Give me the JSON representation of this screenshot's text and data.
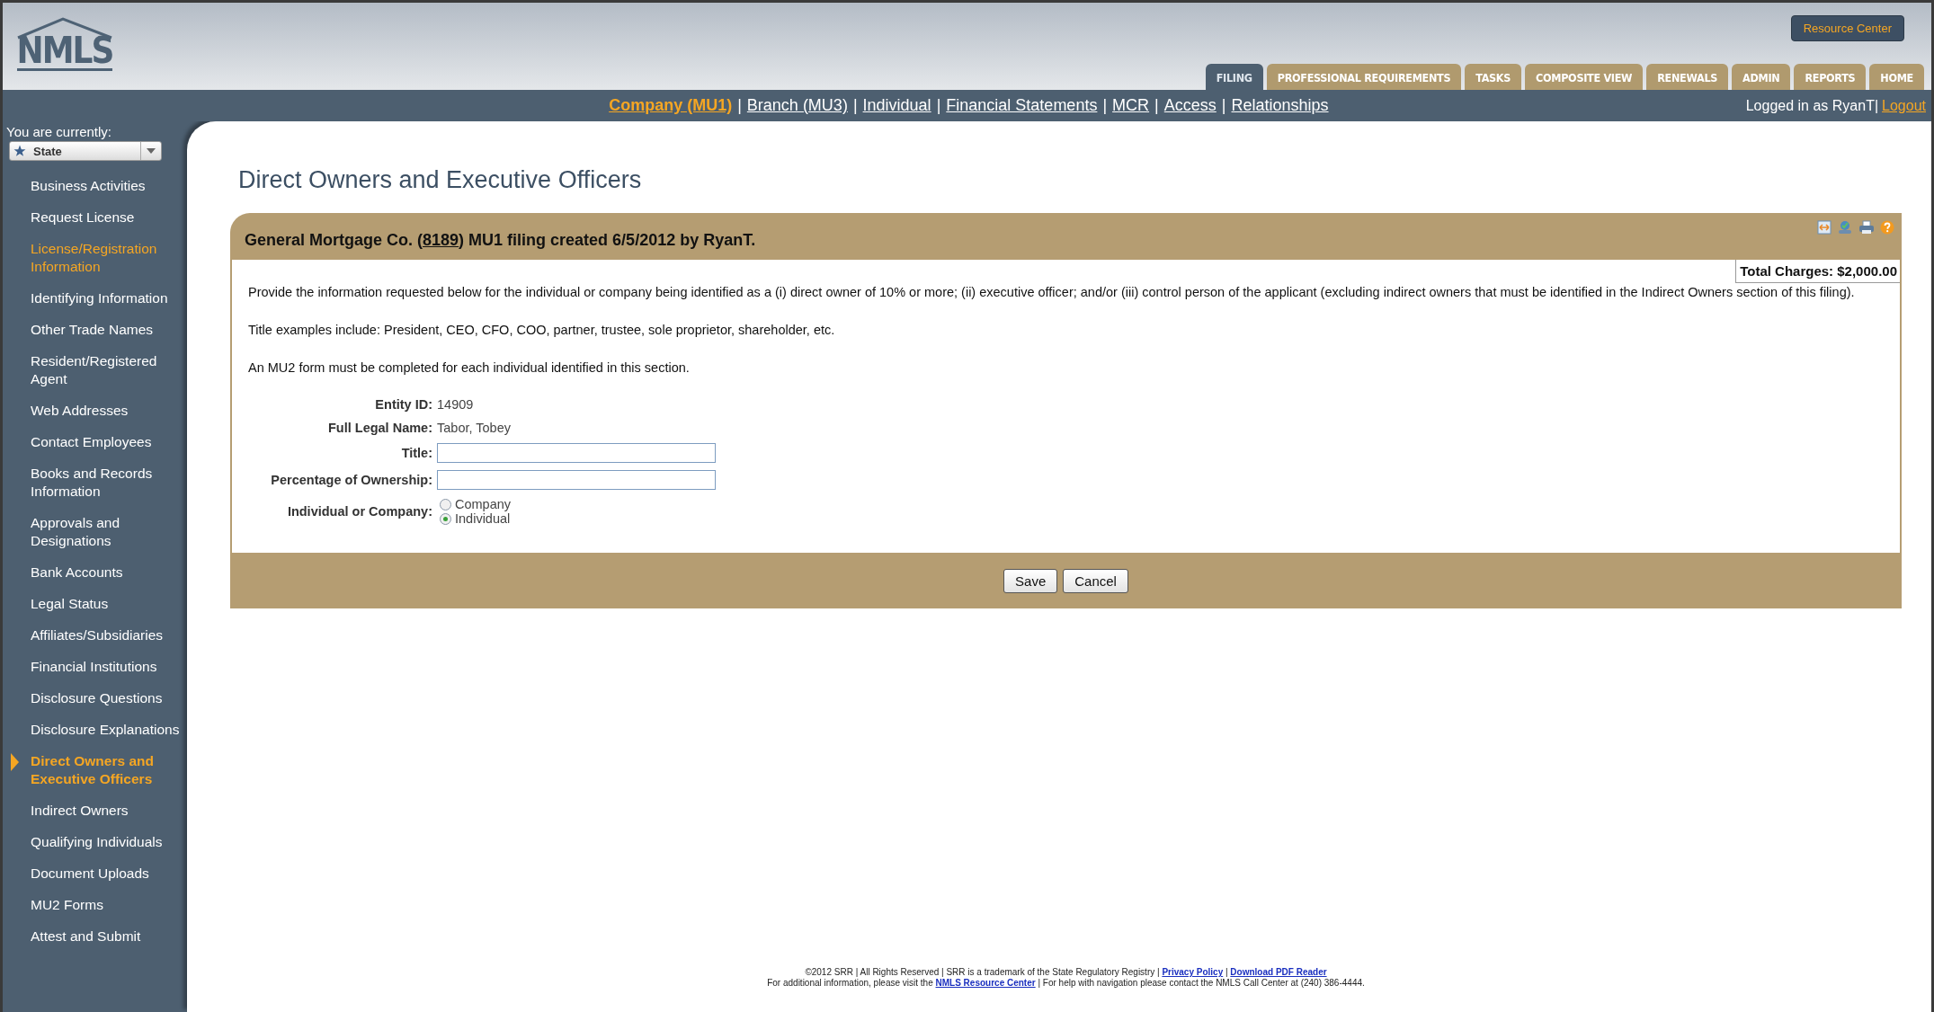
{
  "header": {
    "logo": "NMLS",
    "resource_button": "Resource Center",
    "tabs": [
      {
        "label": "FILING",
        "selected": true
      },
      {
        "label": "PROFESSIONAL REQUIREMENTS",
        "selected": false
      },
      {
        "label": "TASKS",
        "selected": false
      },
      {
        "label": "COMPOSITE VIEW",
        "selected": false
      },
      {
        "label": "RENEWALS",
        "selected": false
      },
      {
        "label": "ADMIN",
        "selected": false
      },
      {
        "label": "REPORTS",
        "selected": false
      },
      {
        "label": "HOME",
        "selected": false
      }
    ]
  },
  "subnav": {
    "separator": "|",
    "links": [
      {
        "label": "Company (MU1)",
        "selected": true
      },
      {
        "label": "Branch (MU3)",
        "selected": false
      },
      {
        "label": "Individual",
        "selected": false
      },
      {
        "label": "Financial Statements",
        "selected": false
      },
      {
        "label": "MCR",
        "selected": false
      },
      {
        "label": "Access",
        "selected": false
      },
      {
        "label": "Relationships",
        "selected": false
      }
    ],
    "logged_in": "Logged in as RyanT|",
    "logout": "Logout"
  },
  "sidebar": {
    "caption": "You are currently:",
    "dropdown": "State",
    "items": [
      {
        "label": "Business Activities",
        "selected": false,
        "highlighted": false
      },
      {
        "label": "Request License",
        "selected": false,
        "highlighted": false
      },
      {
        "label": "License/Registration Information",
        "selected": false,
        "highlighted": true
      },
      {
        "label": "Identifying Information",
        "selected": false,
        "highlighted": false
      },
      {
        "label": "Other Trade Names",
        "selected": false,
        "highlighted": false
      },
      {
        "label": "Resident/Registered Agent",
        "selected": false,
        "highlighted": false
      },
      {
        "label": "Web Addresses",
        "selected": false,
        "highlighted": false
      },
      {
        "label": "Contact Employees",
        "selected": false,
        "highlighted": false
      },
      {
        "label": "Books and Records Information",
        "selected": false,
        "highlighted": false
      },
      {
        "label": "Approvals and Designations",
        "selected": false,
        "highlighted": false
      },
      {
        "label": "Bank Accounts",
        "selected": false,
        "highlighted": false
      },
      {
        "label": "Legal Status",
        "selected": false,
        "highlighted": false
      },
      {
        "label": "Affiliates/Subsidiaries",
        "selected": false,
        "highlighted": false
      },
      {
        "label": "Financial Institutions",
        "selected": false,
        "highlighted": false
      },
      {
        "label": "Disclosure Questions",
        "selected": false,
        "highlighted": false
      },
      {
        "label": "Disclosure Explanations",
        "selected": false,
        "highlighted": false
      },
      {
        "label": "Direct Owners and Executive Officers",
        "selected": true,
        "highlighted": false
      },
      {
        "label": "Indirect Owners",
        "selected": false,
        "highlighted": false
      },
      {
        "label": "Qualifying Individuals",
        "selected": false,
        "highlighted": false
      },
      {
        "label": "Document Uploads",
        "selected": false,
        "highlighted": false
      },
      {
        "label": "MU2 Forms",
        "selected": false,
        "highlighted": false
      },
      {
        "label": "Attest and Submit",
        "selected": false,
        "highlighted": false
      }
    ]
  },
  "page_title": "Direct Owners and Executive Officers",
  "panel": {
    "heading": [
      {
        "kind": "text",
        "text": "General Mortgage Co. ("
      },
      {
        "kind": "link",
        "text": "8189"
      },
      {
        "kind": "text",
        "text": ") MU1 filing created 6/5/2012 by RyanT."
      }
    ],
    "total_charges": "Total Charges: $2,000.00",
    "paragraphs": [
      "Provide the information requested below for the individual or company being identified as a (i) direct owner of 10% or more; (ii) executive officer; and/or (iii) control person of the applicant (excluding indirect owners that must be identified in the Indirect Owners section of this filing).",
      "Title examples include: President, CEO, CFO, COO, partner, trustee, sole proprietor, shareholder, etc.",
      "An MU2 form must be completed for each individual identified in this section."
    ],
    "fields": [
      {
        "kind": "value",
        "label": "Entity ID:",
        "value": "14909"
      },
      {
        "kind": "value",
        "label": "Full Legal Name:",
        "value": "Tabor, Tobey"
      },
      {
        "kind": "input",
        "label": "Title:"
      },
      {
        "kind": "input",
        "label": "Percentage of Ownership:"
      },
      {
        "kind": "radio",
        "label": "Individual or Company:",
        "options": [
          {
            "label": "Company",
            "selected": false
          },
          {
            "label": "Individual",
            "selected": true
          }
        ]
      }
    ],
    "buttons": [
      "Save",
      "Cancel"
    ]
  },
  "footer": [
    [
      {
        "kind": "text",
        "text": "©2012 SRR | All Rights Reserved | SRR is a trademark of the State Regulatory Registry | "
      },
      {
        "kind": "link",
        "text": "Privacy Policy"
      },
      {
        "kind": "text",
        "text": " | "
      },
      {
        "kind": "link",
        "text": "Download PDF Reader"
      }
    ],
    [
      {
        "kind": "text",
        "text": "For additional information, please visit the "
      },
      {
        "kind": "link",
        "text": "NMLS Resource Center"
      },
      {
        "kind": "text",
        "text": " | For help with navigation please contact the NMLS Call Center at (240) 386-4444."
      }
    ]
  ]
}
